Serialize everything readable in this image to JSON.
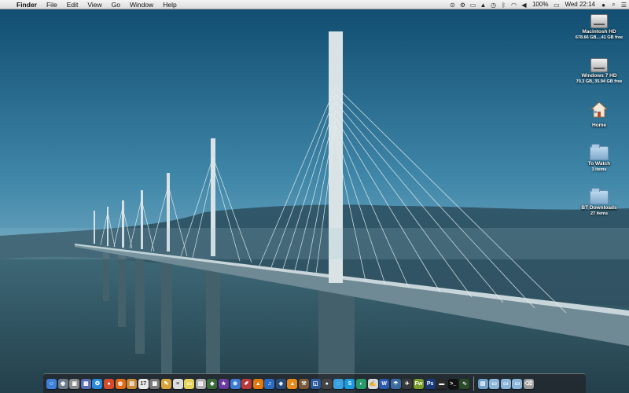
{
  "menubar": {
    "apple_symbol": "",
    "items": [
      "Finder",
      "File",
      "Edit",
      "View",
      "Go",
      "Window",
      "Help"
    ],
    "battery": "100%",
    "clock": "Wed 22:14"
  },
  "desktop_icons": [
    {
      "name": "Macintosh HD",
      "sub": "678.66 GB....41 GB free",
      "icon": "hard-drive-icon"
    },
    {
      "name": "Windows 7 HD",
      "sub": "70.3 GB, 35.94 GB free",
      "icon": "hard-drive-icon"
    },
    {
      "name": "Home",
      "sub": "",
      "icon": "home-folder-icon"
    },
    {
      "name": "To Watch",
      "sub": "3 items",
      "icon": "folder-icon"
    },
    {
      "name": "BT Downloads",
      "sub": "27 items",
      "icon": "folder-icon"
    }
  ],
  "dock": {
    "apps": [
      {
        "id": "finder",
        "color": "#3d7fd9",
        "glyph": "☺"
      },
      {
        "id": "launchpad",
        "color": "#6a7b8c",
        "glyph": "◉"
      },
      {
        "id": "iphoto",
        "color": "#8a8a8a",
        "glyph": "▣"
      },
      {
        "id": "photo-booth",
        "color": "#5a6db0",
        "glyph": "▦"
      },
      {
        "id": "safari",
        "color": "#2a8ad9",
        "glyph": "✪"
      },
      {
        "id": "chrome",
        "color": "#d44b2e",
        "glyph": "●"
      },
      {
        "id": "firefox",
        "color": "#e06b1a",
        "glyph": "◍"
      },
      {
        "id": "preview",
        "color": "#c98a3a",
        "glyph": "▤"
      },
      {
        "id": "calendar",
        "color": "#e8e8e8",
        "glyph": "17"
      },
      {
        "id": "photos",
        "color": "#7a7a7a",
        "glyph": "▩"
      },
      {
        "id": "pages",
        "color": "#d9a53a",
        "glyph": "✎"
      },
      {
        "id": "textedit",
        "color": "#dcdcdc",
        "glyph": "≡"
      },
      {
        "id": "notes",
        "color": "#e6d25a",
        "glyph": "▭"
      },
      {
        "id": "preferences",
        "color": "#b0b0b0",
        "glyph": "▨"
      },
      {
        "id": "cleaner",
        "color": "#3b6a3b",
        "glyph": "◆"
      },
      {
        "id": "imovie",
        "color": "#6a3aa0",
        "glyph": "★"
      },
      {
        "id": "app-store",
        "color": "#3a7ad0",
        "glyph": "⊛"
      },
      {
        "id": "paint",
        "color": "#b83a3a",
        "glyph": "✐"
      },
      {
        "id": "vlc",
        "color": "#e07a10",
        "glyph": "▲"
      },
      {
        "id": "itunes",
        "color": "#2a6ac0",
        "glyph": "♫"
      },
      {
        "id": "utility",
        "color": "#2a4a7a",
        "glyph": "◈"
      },
      {
        "id": "vlc-2",
        "color": "#e88a1a",
        "glyph": "▲"
      },
      {
        "id": "tools",
        "color": "#7a5a3a",
        "glyph": "⚒"
      },
      {
        "id": "virtual-machine",
        "color": "#2a5a9a",
        "glyph": "◱"
      },
      {
        "id": "facetime",
        "color": "#444444",
        "glyph": "●"
      },
      {
        "id": "messages",
        "color": "#3aa0e0",
        "glyph": "◌"
      },
      {
        "id": "skype",
        "color": "#1a9ae0",
        "glyph": "S"
      },
      {
        "id": "editor",
        "color": "#2a9a6a",
        "glyph": "◐"
      },
      {
        "id": "script",
        "color": "#d8d8d8",
        "glyph": "✍"
      },
      {
        "id": "word",
        "color": "#2a5ab0",
        "glyph": "W"
      },
      {
        "id": "umbrella",
        "color": "#3a6aa0",
        "glyph": "☂"
      },
      {
        "id": "terminal-2",
        "color": "#3a3a3a",
        "glyph": "✈"
      },
      {
        "id": "fireworks",
        "color": "#7a9a2a",
        "glyph": "Fw"
      },
      {
        "id": "photoshop",
        "color": "#1a3a7a",
        "glyph": "Ps"
      },
      {
        "id": "monitor",
        "color": "#2a2a2a",
        "glyph": "▬"
      },
      {
        "id": "terminal",
        "color": "#111111",
        "glyph": ">_"
      },
      {
        "id": "activity-monitor",
        "color": "#2a4a2a",
        "glyph": "∿"
      }
    ],
    "stacks": [
      {
        "id": "apps-folder",
        "color": "#6fa0cc",
        "glyph": "▤"
      },
      {
        "id": "documents-folder",
        "color": "#8ab4d8",
        "glyph": "▭"
      },
      {
        "id": "downloads-folder",
        "color": "#8ab4d8",
        "glyph": "▭"
      },
      {
        "id": "stack-folder",
        "color": "#8ab4d8",
        "glyph": "▭"
      },
      {
        "id": "trash",
        "color": "#9a9a9a",
        "glyph": "⌫"
      }
    ]
  }
}
